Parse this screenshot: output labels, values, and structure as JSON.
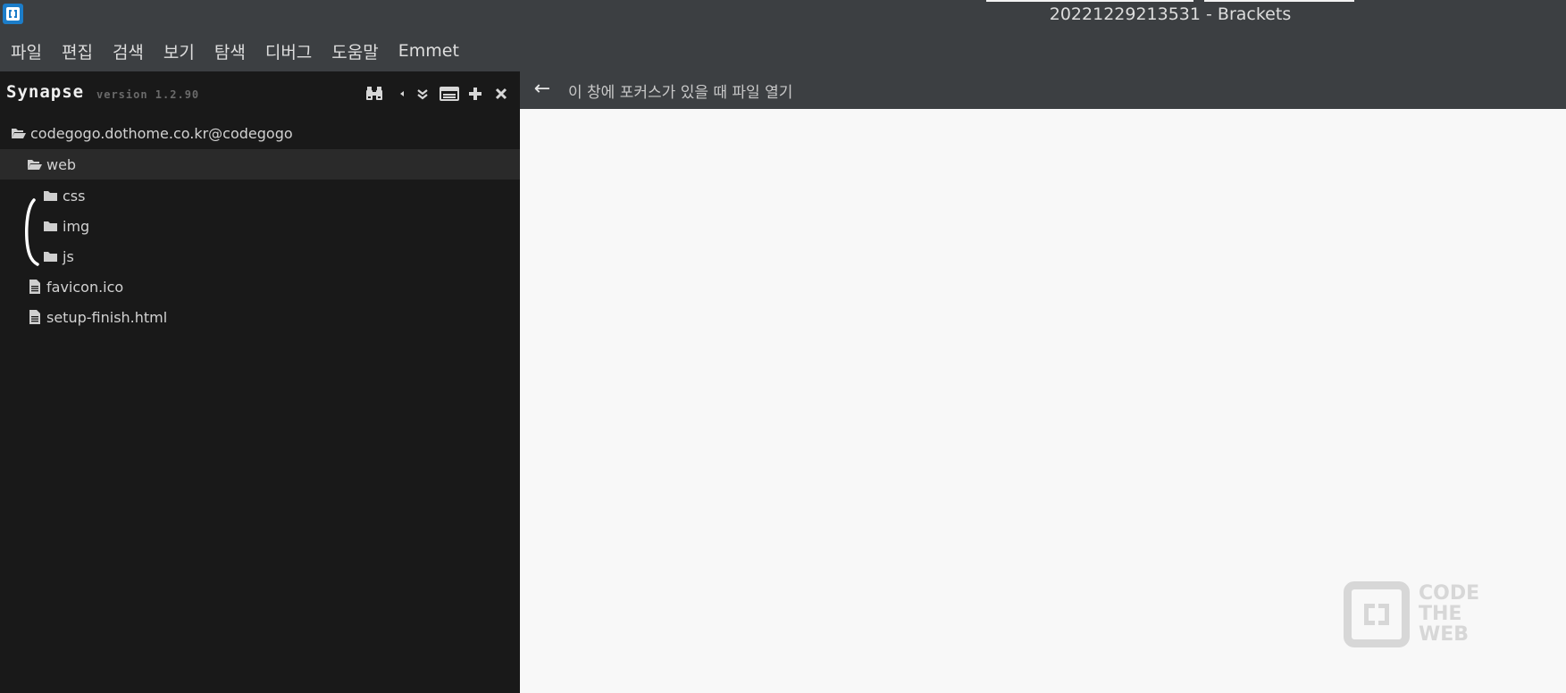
{
  "window": {
    "title": "20221229213531 - Brackets"
  },
  "menu": {
    "items": [
      "파일",
      "편집",
      "검색",
      "보기",
      "탐색",
      "디버그",
      "도움말",
      "Emmet"
    ]
  },
  "sidebar": {
    "title": "Synapse",
    "version": "version 1.2.90",
    "header_icons": [
      "binoculars-icon",
      "chevron-left-icon",
      "double-chevron-down-icon",
      "panel-icon",
      "plus-icon",
      "close-icon"
    ],
    "tree": [
      {
        "label": "codegogo.dothome.co.kr@codegogo",
        "type": "folder-open",
        "level": 0
      },
      {
        "label": "web",
        "type": "folder-open",
        "level": 1,
        "selected": true
      },
      {
        "label": "css",
        "type": "folder",
        "level": 2
      },
      {
        "label": "img",
        "type": "folder",
        "level": 2
      },
      {
        "label": "js",
        "type": "folder",
        "level": 2
      },
      {
        "label": "favicon.ico",
        "type": "file",
        "level": 1
      },
      {
        "label": "setup-finish.html",
        "type": "file",
        "level": 1
      }
    ]
  },
  "editor": {
    "bar_text": "이 창에 포커스가 있을 때 파일 열기",
    "back_icon": "←",
    "watermark": {
      "lines": [
        "CODE",
        "THE",
        "WEB"
      ]
    }
  },
  "colors": {
    "sidebar_bg": "#191919",
    "chrome_bg": "#3c3f42",
    "editor_bg": "#f8f8f8",
    "accent": "#1c7dc9"
  }
}
